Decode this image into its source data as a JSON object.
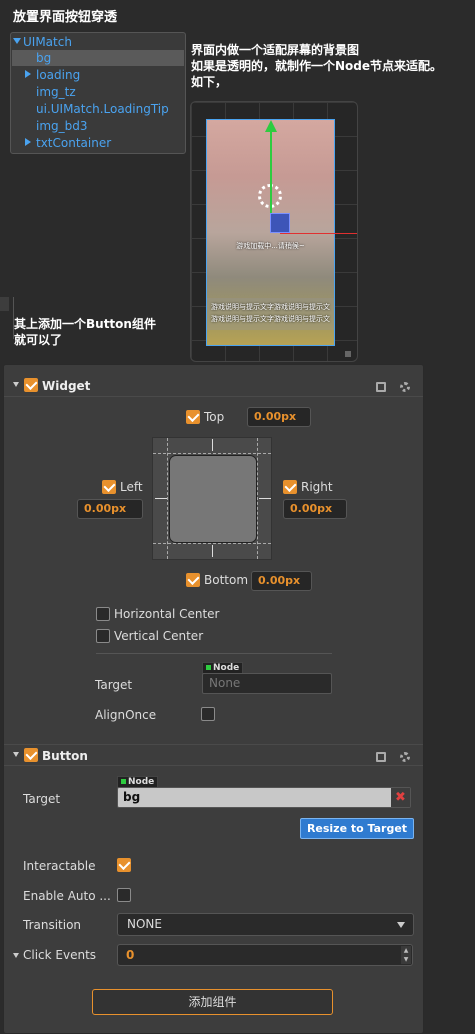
{
  "notes": {
    "top": "放置界面按钮穿透",
    "right": "界面内做一个适配屏幕的背景图\n如果是透明的，就制作一个Node节点来适配。\n如下，",
    "left": "其上添加一个Button组件\n就可以了"
  },
  "tree": {
    "root": "UIMatch",
    "items": [
      "bg",
      "loading",
      "img_tz",
      "ui.UIMatch.LoadingTip",
      "img_bd3",
      "txtContainer"
    ]
  },
  "scene": {
    "loading_text": "游戏加载中...请稍候~",
    "tip_line1": "游戏说明与提示文字游戏说明与提示文",
    "tip_line2": "游戏说明与提示文字游戏说明与提示文"
  },
  "widget": {
    "title": "Widget",
    "top_label": "Top",
    "top_value": "0.00px",
    "left_label": "Left",
    "left_value": "0.00px",
    "right_label": "Right",
    "right_value": "0.00px",
    "bottom_label": "Bottom",
    "bottom_value": "0.00px",
    "hcenter_label": "Horizontal Center",
    "vcenter_label": "Vertical Center",
    "target_label": "Target",
    "target_tag": "Node",
    "target_placeholder": "None",
    "alignonce_label": "AlignOnce"
  },
  "button": {
    "title": "Button",
    "target_label": "Target",
    "target_tag": "Node",
    "target_value": "bg",
    "resize_label": "Resize to Target",
    "interactable_label": "Interactable",
    "enable_auto_label": "Enable Auto ...",
    "transition_label": "Transition",
    "transition_value": "NONE",
    "click_events_label": "Click Events",
    "click_events_value": "0"
  },
  "add_component": "添加组件",
  "colors": {
    "accent": "#e8912d",
    "link": "#4aa3f0",
    "button_blue": "#2f7bd0"
  }
}
